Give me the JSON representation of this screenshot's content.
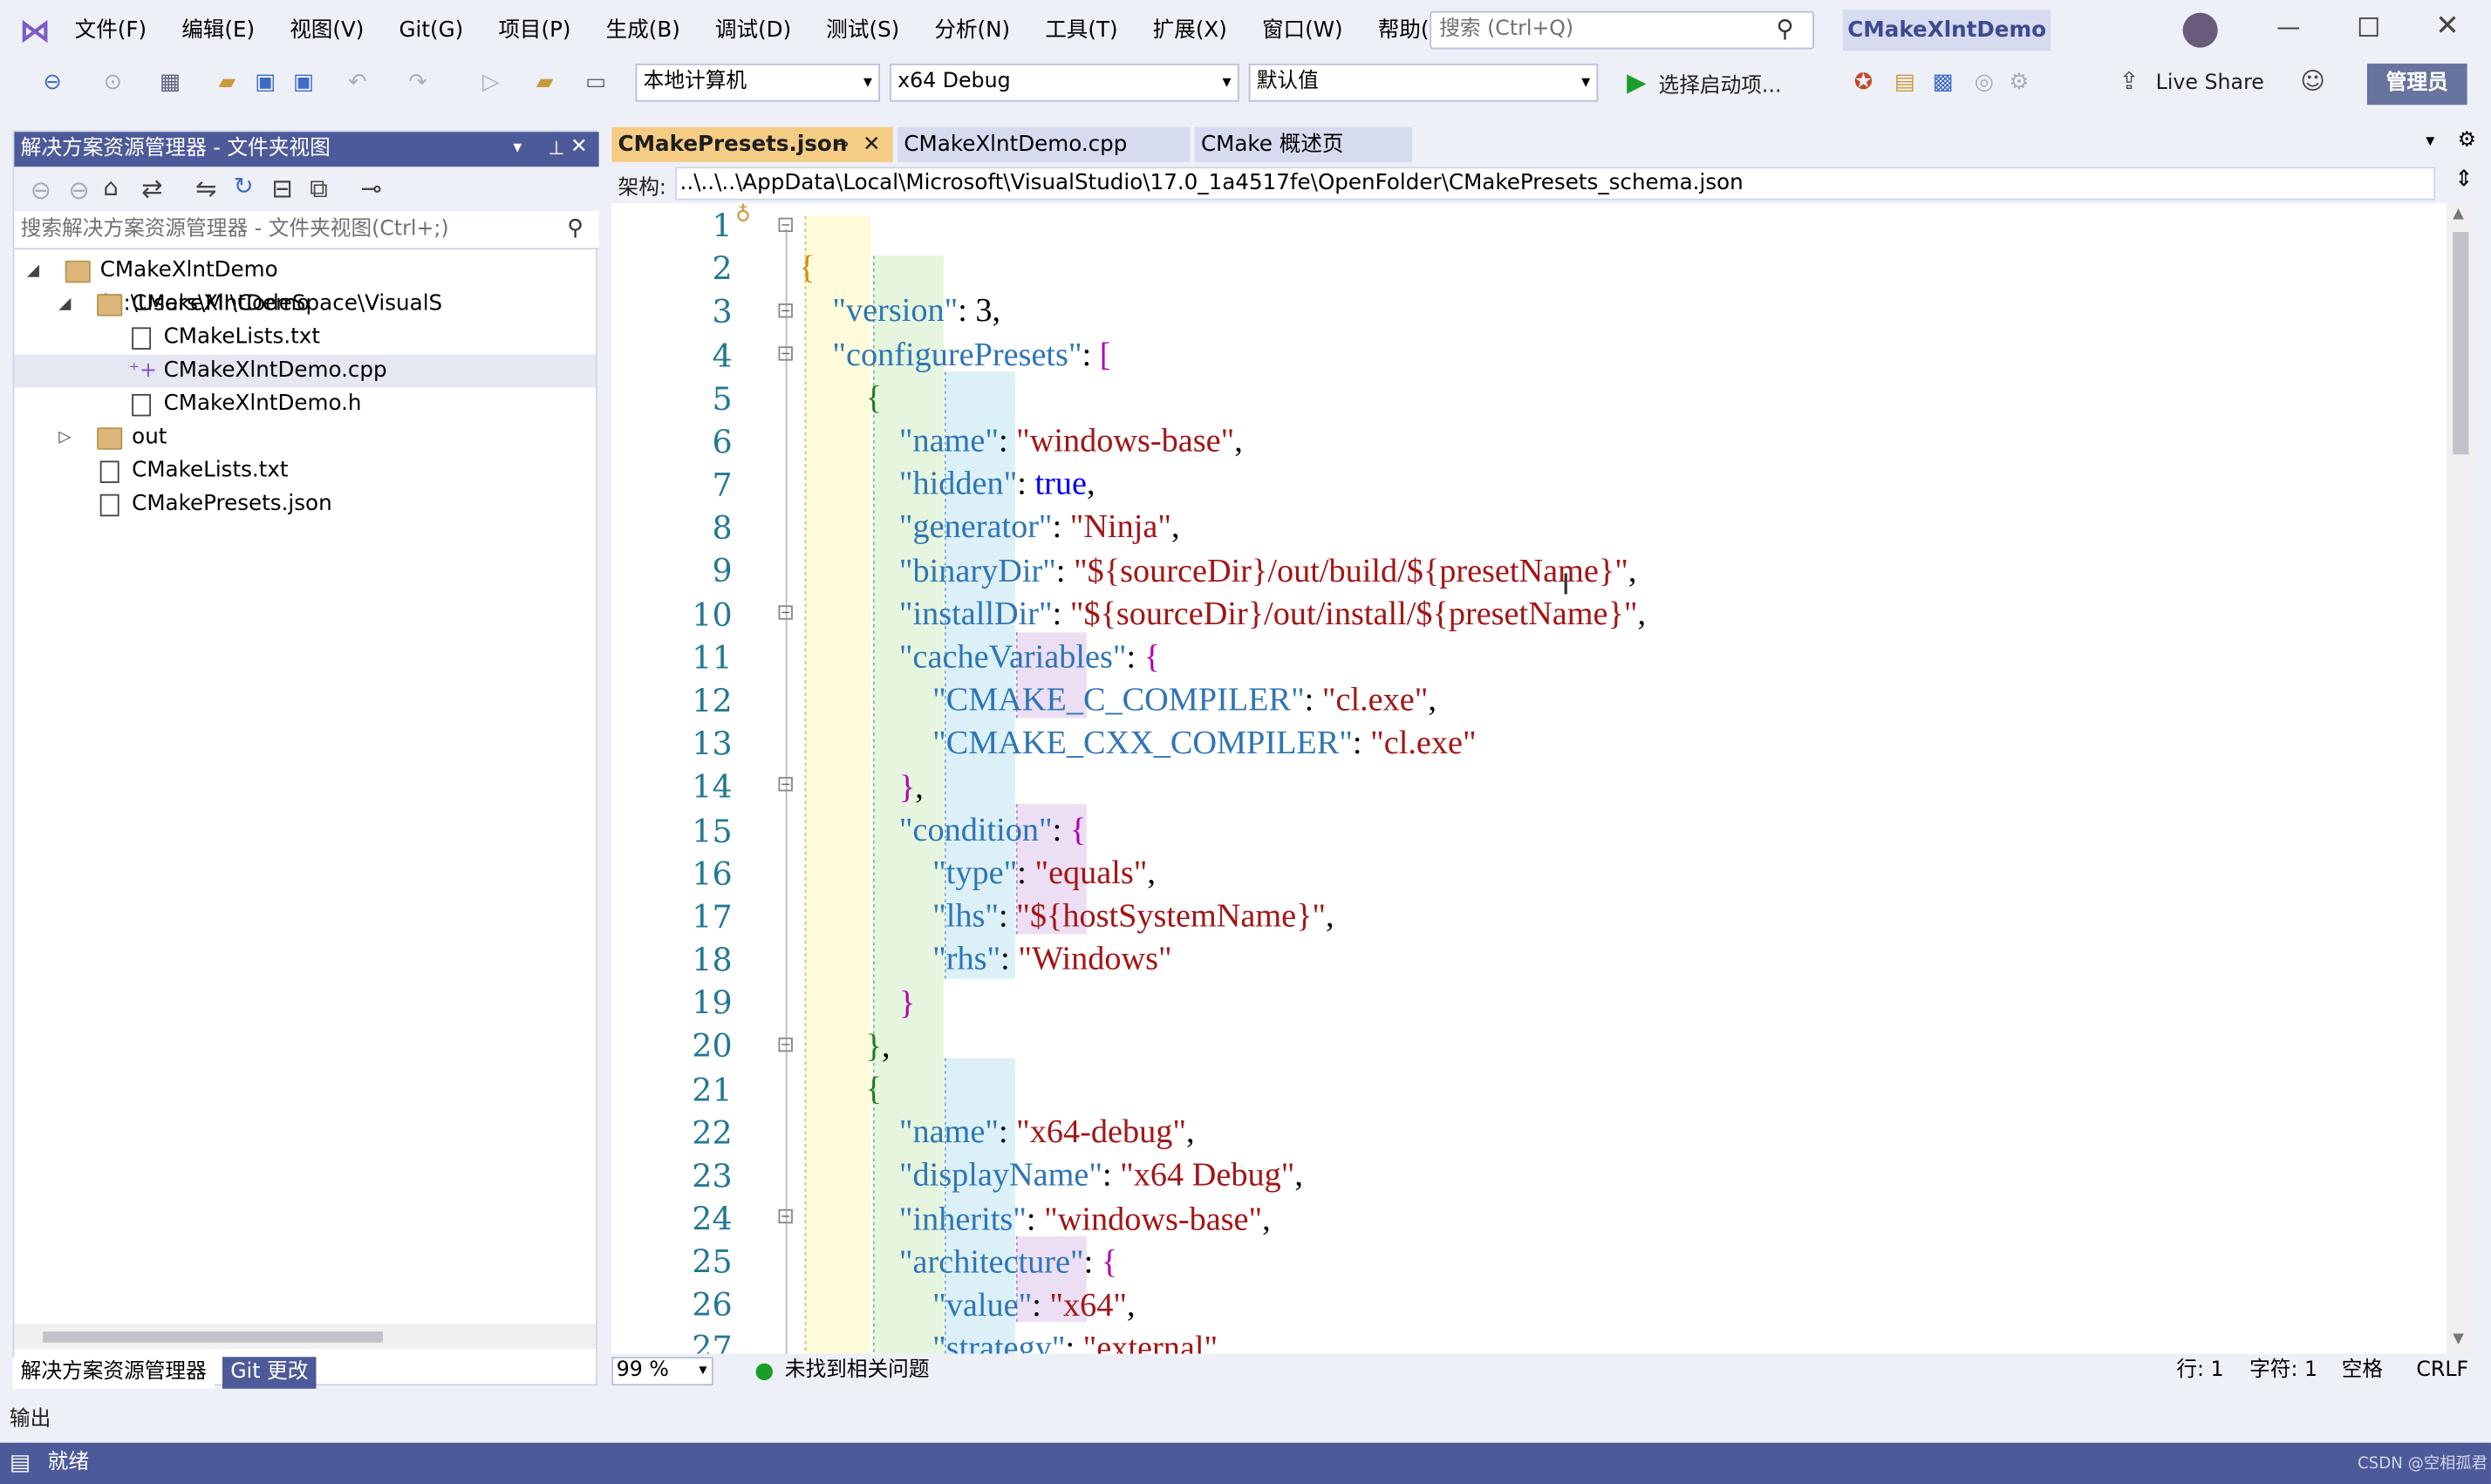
{
  "titlebar": {
    "menu": [
      "文件(F)",
      "编辑(E)",
      "视图(V)",
      "Git(G)",
      "项目(P)",
      "生成(B)",
      "调试(D)",
      "测试(S)",
      "分析(N)",
      "工具(T)",
      "扩展(X)",
      "窗口(W)",
      "帮助(H)"
    ],
    "search_placeholder": "搜索 (Ctrl+Q)",
    "solution_name": "CMakeXlntDemo"
  },
  "toolbar": {
    "target_machine": "本地计算机",
    "config": "x64 Debug",
    "default_value": "默认值",
    "start_label": "选择启动项...",
    "live_share": "Live Share",
    "admin": "管理员"
  },
  "explorer": {
    "title": "解决方案资源管理器 - 文件夹视图",
    "search_placeholder": "搜索解决方案资源管理器 - 文件夹视图(Ctrl+;)",
    "nodes": [
      {
        "label": "CMakeXlntDemo (C:\\Users\\MI\\CodeSpace\\VisualS",
        "type": "folder"
      },
      {
        "label": "CMakeXlntDemo",
        "type": "folder"
      },
      {
        "label": "CMakeLists.txt",
        "type": "file"
      },
      {
        "label": "CMakeXlntDemo.cpp",
        "type": "file"
      },
      {
        "label": "CMakeXlntDemo.h",
        "type": "file"
      },
      {
        "label": "out",
        "type": "folder"
      },
      {
        "label": "CMakeLists.txt",
        "type": "file"
      },
      {
        "label": "CMakePresets.json",
        "type": "file"
      }
    ],
    "bottom_tabs": [
      "解决方案资源管理器",
      "Git 更改"
    ]
  },
  "editor": {
    "tabs": [
      "CMakePresets.json",
      "CMakeXlntDemo.cpp",
      "CMake 概述页"
    ],
    "schema_label": "架构:",
    "schema_path": "..\\..\\..\\AppData\\Local\\Microsoft\\VisualStudio\\17.0_1a4517fe\\OpenFolder\\CMakePresets_schema.json",
    "line_numbers": [
      "1",
      "2",
      "3",
      "4",
      "5",
      "6",
      "7",
      "8",
      "9",
      "10",
      "11",
      "12",
      "13",
      "14",
      "15",
      "16",
      "17",
      "18",
      "19",
      "20",
      "21",
      "22",
      "23",
      "24",
      "25",
      "26",
      "27"
    ],
    "zoom": "99 %",
    "issues": "未找到相关问题",
    "line": "行: 1",
    "char": "字符: 1",
    "indent": "空格",
    "eol": "CRLF"
  },
  "output_title": "输出",
  "status": "就绪",
  "watermark": "CSDN @空相孤君"
}
